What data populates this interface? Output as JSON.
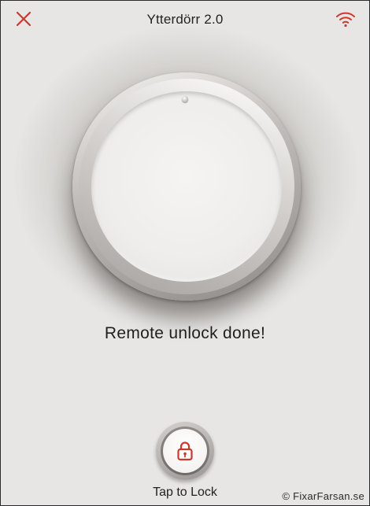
{
  "header": {
    "title": "Ytterdörr 2.0",
    "close_icon": "close-icon",
    "connection_icon": "wifi-icon"
  },
  "dial": {
    "indicator_icon": "dial-indicator-dot"
  },
  "status": {
    "message": "Remote unlock done!"
  },
  "lock_action": {
    "icon": "padlock-icon",
    "label": "Tap to Lock"
  },
  "watermark": {
    "text": "© FixarFarsan.se"
  },
  "colors": {
    "accent": "#c8392f",
    "background": "#e8e6e4",
    "text": "#222222"
  }
}
